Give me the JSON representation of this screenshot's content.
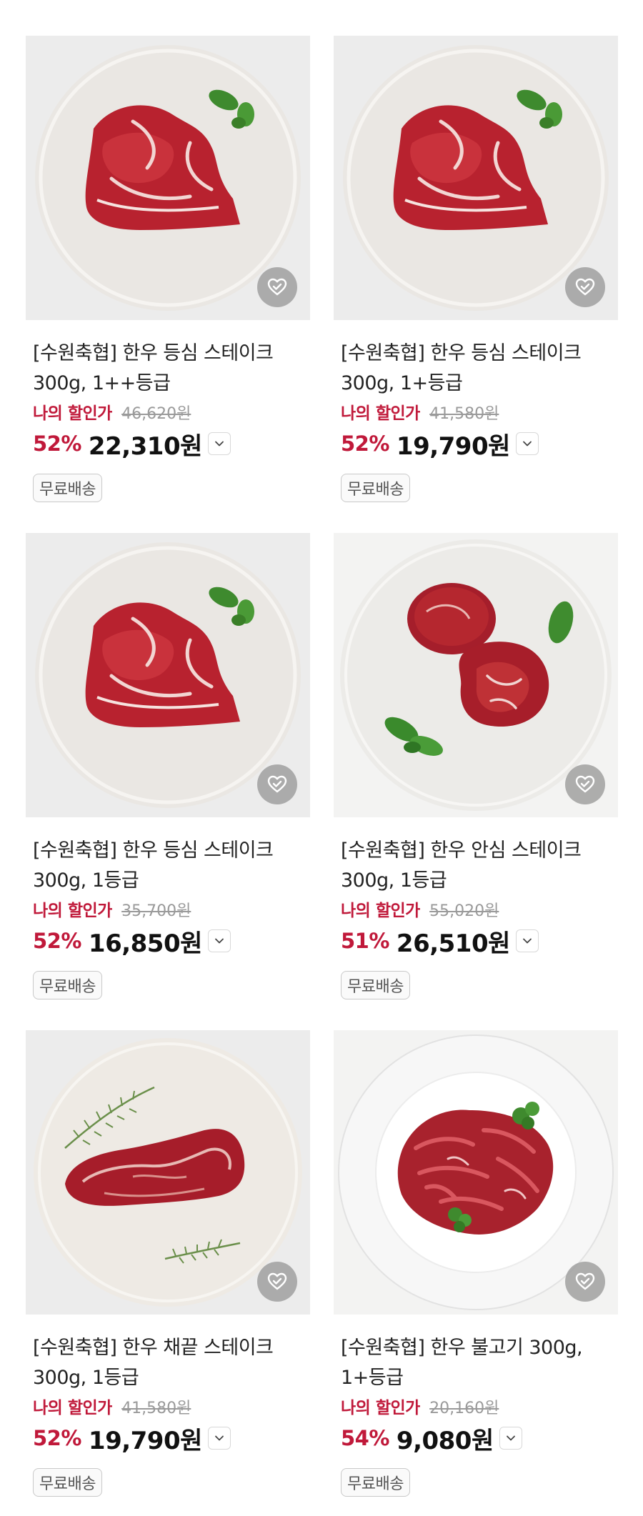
{
  "products": [
    {
      "title": "[수원축협] 한우 등심 스테이크 300g, 1++등급",
      "discount_label": "나의 할인가",
      "original_price": "46,620원",
      "discount_pct": "52%",
      "price": "22,310원",
      "badge": "무료배송",
      "image": "ribeye-steak-plate"
    },
    {
      "title": "[수원축협] 한우 등심 스테이크 300g, 1+등급",
      "discount_label": "나의 할인가",
      "original_price": "41,580원",
      "discount_pct": "52%",
      "price": "19,790원",
      "badge": "무료배송",
      "image": "ribeye-steak-plate"
    },
    {
      "title": "[수원축협] 한우 등심 스테이크 300g, 1등급",
      "discount_label": "나의 할인가",
      "original_price": "35,700원",
      "discount_pct": "52%",
      "price": "16,850원",
      "badge": "무료배송",
      "image": "ribeye-steak-plate"
    },
    {
      "title": "[수원축협] 한우 안심 스테이크 300g, 1등급",
      "discount_label": "나의 할인가",
      "original_price": "55,020원",
      "discount_pct": "51%",
      "price": "26,510원",
      "badge": "무료배송",
      "image": "tenderloin-steak-plate"
    },
    {
      "title": "[수원축협] 한우 채끝 스테이크 300g, 1등급",
      "discount_label": "나의 할인가",
      "original_price": "41,580원",
      "discount_pct": "52%",
      "price": "19,790원",
      "badge": "무료배송",
      "image": "striploin-steak-plate"
    },
    {
      "title": "[수원축협] 한우 불고기 300g, 1+등급",
      "discount_label": "나의 할인가",
      "original_price": "20,160원",
      "discount_pct": "54%",
      "price": "9,080원",
      "badge": "무료배송",
      "image": "bulgogi-plate"
    }
  ],
  "icons": {
    "wishlist": "heart-check-icon",
    "options": "chevron-down-icon"
  },
  "colors": {
    "accent": "#c0193a",
    "strike": "#9a9a9a",
    "wishlist_bg": "#a0a0a0"
  }
}
